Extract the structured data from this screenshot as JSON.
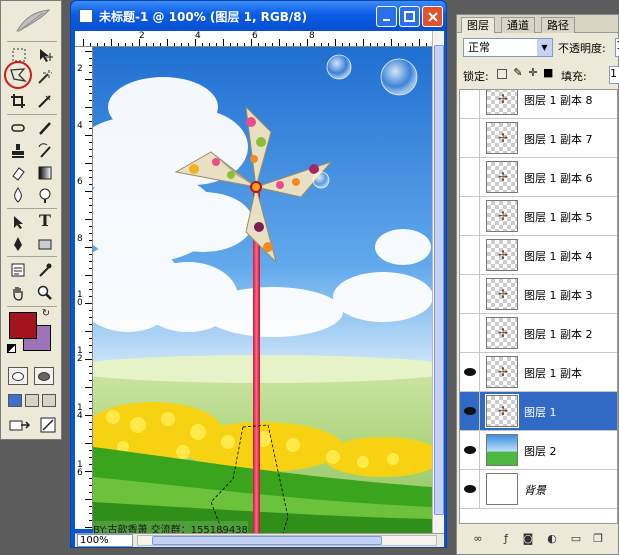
{
  "document": {
    "title": "未标题-1 @ 100% (图层 1, RGB/8)",
    "zoom": "100%",
    "watermark": "BY:古歆香萧 交流群：155189438",
    "ruler_top_labels": [
      "2",
      "4",
      "6",
      "8"
    ],
    "ruler_left_labels": [
      "2",
      "4",
      "6",
      "8",
      "1 0",
      "1 2",
      "1 4",
      "1 6"
    ]
  },
  "layers_panel": {
    "tabs": [
      "图层",
      "通道",
      "路径"
    ],
    "active_tab": "图层",
    "blend_mode": "正常",
    "opacity_label": "不透明度:",
    "opacity_value": "1",
    "lock_label": "锁定:",
    "fill_label": "填充:",
    "fill_value": "1",
    "layers": [
      {
        "name": "图层 1 副本 8",
        "visible": false,
        "selected": false,
        "thumb": "transparent"
      },
      {
        "name": "图层 1 副本 7",
        "visible": false,
        "selected": false,
        "thumb": "transparent"
      },
      {
        "name": "图层 1 副本 6",
        "visible": false,
        "selected": false,
        "thumb": "transparent"
      },
      {
        "name": "图层 1 副本 5",
        "visible": false,
        "selected": false,
        "thumb": "transparent"
      },
      {
        "name": "图层 1 副本 4",
        "visible": false,
        "selected": false,
        "thumb": "transparent"
      },
      {
        "name": "图层 1 副本 3",
        "visible": false,
        "selected": false,
        "thumb": "transparent"
      },
      {
        "name": "图层 1 副本 2",
        "visible": false,
        "selected": false,
        "thumb": "transparent"
      },
      {
        "name": "图层 1 副本",
        "visible": true,
        "selected": false,
        "thumb": "transparent"
      },
      {
        "name": "图层 1",
        "visible": true,
        "selected": true,
        "thumb": "transparent"
      },
      {
        "name": "图层 2",
        "visible": true,
        "selected": false,
        "thumb": "sky"
      },
      {
        "name": "背景",
        "visible": true,
        "selected": false,
        "thumb": "white"
      }
    ]
  },
  "toolbox": {
    "foreground_color": "#a3151e",
    "background_color": "#9e73b8",
    "highlighted_tool": "polygonal-lasso-tool"
  },
  "colors": {
    "selection_highlight": "#316ac5",
    "titlebar": "#0a5ce6",
    "annotation_circle": "#d21a1a"
  }
}
